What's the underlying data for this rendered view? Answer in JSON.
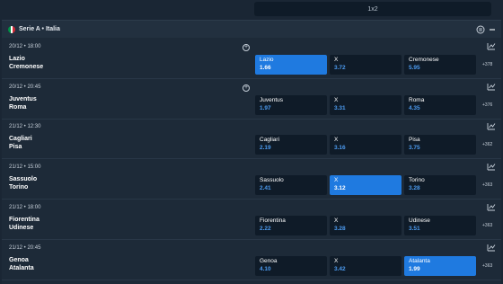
{
  "market_select": {
    "label": "1x2"
  },
  "league": {
    "name": "Serie A • Italia",
    "flag_colors": [
      "#009246",
      "#ffffff",
      "#ce2b37"
    ]
  },
  "colors": {
    "selected": "#1f7ae0",
    "odds_value": "#4c9bf0"
  },
  "matches": [
    {
      "time": "20/12 • 18:00",
      "home": "Lazio",
      "away": "Cremonese",
      "has_add": true,
      "odds": [
        {
          "label": "Lazio",
          "value": "1.66",
          "selected": true
        },
        {
          "label": "X",
          "value": "3.72",
          "selected": false
        },
        {
          "label": "Cremonese",
          "value": "5.95",
          "selected": false
        }
      ],
      "more": "+378"
    },
    {
      "time": "20/12 • 20:45",
      "home": "Juventus",
      "away": "Roma",
      "has_add": true,
      "odds": [
        {
          "label": "Juventus",
          "value": "1.97",
          "selected": false
        },
        {
          "label": "X",
          "value": "3.31",
          "selected": false
        },
        {
          "label": "Roma",
          "value": "4.35",
          "selected": false
        }
      ],
      "more": "+376"
    },
    {
      "time": "21/12 • 12:30",
      "home": "Cagliari",
      "away": "Pisa",
      "has_add": false,
      "odds": [
        {
          "label": "Cagliari",
          "value": "2.19",
          "selected": false
        },
        {
          "label": "X",
          "value": "3.16",
          "selected": false
        },
        {
          "label": "Pisa",
          "value": "3.75",
          "selected": false
        }
      ],
      "more": "+362"
    },
    {
      "time": "21/12 • 15:00",
      "home": "Sassuolo",
      "away": "Torino",
      "has_add": false,
      "odds": [
        {
          "label": "Sassuolo",
          "value": "2.41",
          "selected": false
        },
        {
          "label": "X",
          "value": "3.12",
          "selected": true
        },
        {
          "label": "Torino",
          "value": "3.28",
          "selected": false
        }
      ],
      "more": "+363"
    },
    {
      "time": "21/12 • 18:00",
      "home": "Fiorentina",
      "away": "Udinese",
      "has_add": false,
      "odds": [
        {
          "label": "Fiorentina",
          "value": "2.22",
          "selected": false
        },
        {
          "label": "X",
          "value": "3.28",
          "selected": false
        },
        {
          "label": "Udinese",
          "value": "3.51",
          "selected": false
        }
      ],
      "more": "+363"
    },
    {
      "time": "21/12 • 20:45",
      "home": "Genoa",
      "away": "Atalanta",
      "has_add": false,
      "odds": [
        {
          "label": "Genoa",
          "value": "4.10",
          "selected": false
        },
        {
          "label": "X",
          "value": "3.42",
          "selected": false
        },
        {
          "label": "Atalanta",
          "value": "1.99",
          "selected": true
        }
      ],
      "more": "+363"
    }
  ]
}
